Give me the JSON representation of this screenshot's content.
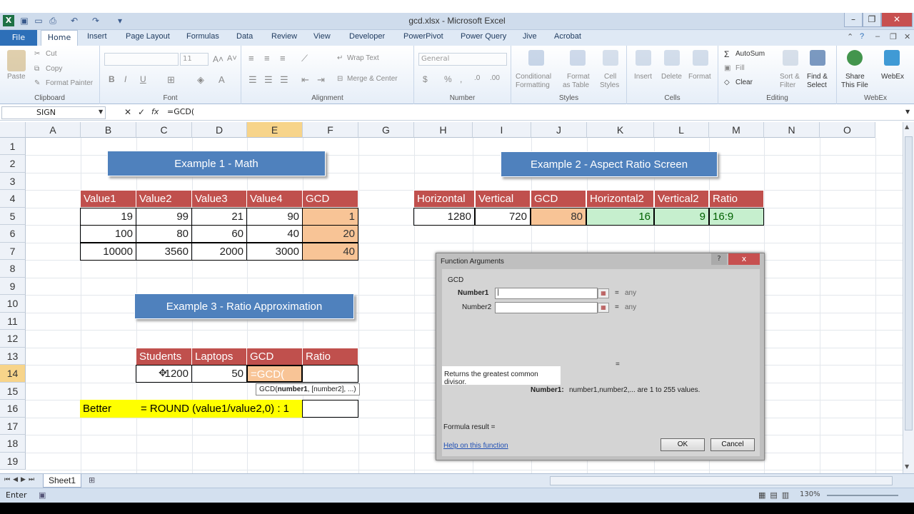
{
  "window": {
    "title": "gcd.xlsx - Microsoft Excel"
  },
  "tabs": {
    "file": "File",
    "home": "Home",
    "others": [
      "Insert",
      "Page Layout",
      "Formulas",
      "Data",
      "Review",
      "View",
      "Developer",
      "PowerPivot",
      "Power Query",
      "Jive",
      "Acrobat"
    ]
  },
  "ribbon": {
    "clipboard": {
      "paste": "Paste",
      "cut": "Cut",
      "copy": "Copy",
      "format_painter": "Format Painter",
      "label": "Clipboard"
    },
    "font": {
      "size": "11",
      "label": "Font",
      "bold": "B",
      "italic": "I",
      "underline": "U"
    },
    "alignment": {
      "wrap": "Wrap Text",
      "merge": "Merge & Center",
      "label": "Alignment"
    },
    "number": {
      "format": "General",
      "label": "Number",
      "currency": "$",
      "percent": "%"
    },
    "styles": {
      "conditional": "Conditional",
      "conditional2": "Formatting",
      "format_table": "Format",
      "format_table2": "as Table",
      "cell_styles": "Cell",
      "cell_styles2": "Styles",
      "label": "Styles"
    },
    "cells": {
      "insert": "Insert",
      "delete": "Delete",
      "format": "Format",
      "label": "Cells"
    },
    "editing": {
      "autosum": "AutoSum",
      "fill": "Fill",
      "clear": "Clear",
      "sort": "Sort &",
      "sort2": "Filter",
      "find": "Find &",
      "find2": "Select",
      "label": "Editing"
    },
    "webex": {
      "share": "Share",
      "share2": "This File",
      "webex": "WebEx",
      "label": "WebEx"
    }
  },
  "formula_bar": {
    "name_box": "SIGN",
    "formula": "=GCD("
  },
  "columns": [
    "A",
    "B",
    "C",
    "D",
    "E",
    "F",
    "G",
    "H",
    "I",
    "J",
    "K",
    "L",
    "M",
    "N",
    "O"
  ],
  "rows": [
    "1",
    "2",
    "3",
    "4",
    "5",
    "6",
    "7",
    "8",
    "9",
    "10",
    "11",
    "12",
    "13",
    "14",
    "15",
    "16",
    "17",
    "18",
    "19"
  ],
  "example1": {
    "banner": "Example 1 - Math",
    "headers": [
      "Value1",
      "Value2",
      "Value3",
      "Value4",
      "GCD"
    ],
    "rows": [
      [
        "19",
        "99",
        "21",
        "90",
        "1"
      ],
      [
        "100",
        "80",
        "60",
        "40",
        "20"
      ],
      [
        "10000",
        "3560",
        "2000",
        "3000",
        "40"
      ]
    ]
  },
  "example2": {
    "banner": "Example 2 - Aspect Ratio Screen",
    "headers": [
      "Horizontal",
      "Vertical",
      "GCD",
      "Horizontal2",
      "Vertical2",
      "Ratio"
    ],
    "row": [
      "1280",
      "720",
      "80",
      "16",
      "9",
      "16:9"
    ]
  },
  "example3": {
    "banner": "Example 3 - Ratio Approximation",
    "headers": [
      "Students",
      "Laptops",
      "GCD",
      "Ratio"
    ],
    "row": [
      "1200",
      "50",
      "=GCD(",
      ""
    ],
    "tooltip_prefix": "GCD(",
    "tooltip_bold": "number1",
    "tooltip_rest": ", [number2], ...)"
  },
  "better": {
    "label": "Better",
    "formula": "= ROUND (value1/value2,0) : 1"
  },
  "dialog": {
    "title": "Function Arguments",
    "help_btn": "?",
    "close_btn": "x",
    "function_name": "GCD",
    "arg1_label": "Number1",
    "arg2_label": "Number2",
    "arg1_hint": "any",
    "arg2_hint": "any",
    "equals": "=",
    "description": "Returns the greatest common divisor.",
    "arg_desc_label": "Number1:",
    "arg_desc": "number1,number2,... are 1 to 255 values.",
    "formula_result": "Formula result =",
    "help_link": "Help on this function",
    "ok": "OK",
    "cancel": "Cancel"
  },
  "sheet_tabs": {
    "active": "Sheet1"
  },
  "status": {
    "mode": "Enter",
    "zoom": "130%"
  }
}
